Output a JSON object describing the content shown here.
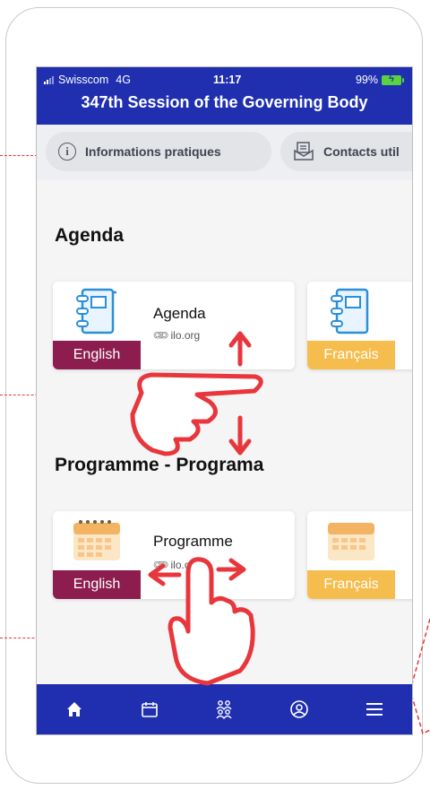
{
  "status_bar": {
    "carrier": "Swisscom",
    "network": "4G",
    "time": "11:17",
    "battery": "99%"
  },
  "header": {
    "title": "347th Session of the Governing Body",
    "color": "#1f2fb0"
  },
  "chips": [
    {
      "label": "Informations pratiques",
      "icon": "info-icon"
    },
    {
      "label": "Contacts util",
      "icon": "contacts-icon"
    }
  ],
  "sections": [
    {
      "title": "Agenda",
      "cards": [
        {
          "title": "Agenda",
          "source": "ilo.org",
          "lang": "English",
          "lang_color": "#8c1d4e",
          "icon": "notebook-icon"
        },
        {
          "title": "",
          "source": "",
          "lang": "Français",
          "lang_color": "#f5bd4d",
          "icon": "notebook-icon"
        }
      ]
    },
    {
      "title": "Programme - Programa",
      "cards": [
        {
          "title": "Programme",
          "source": "ilo.org",
          "lang": "English",
          "lang_color": "#8c1d4e",
          "icon": "calendar-icon"
        },
        {
          "title": "",
          "source": "",
          "lang": "Français",
          "lang_color": "#f5bd4d",
          "icon": "calendar-icon"
        }
      ]
    }
  ],
  "tabbar": {
    "items": [
      "home-icon",
      "calendar-tab-icon",
      "people-icon",
      "profile-icon",
      "menu-icon"
    ],
    "active": "home-icon"
  },
  "annotation_color": "#e8363c"
}
